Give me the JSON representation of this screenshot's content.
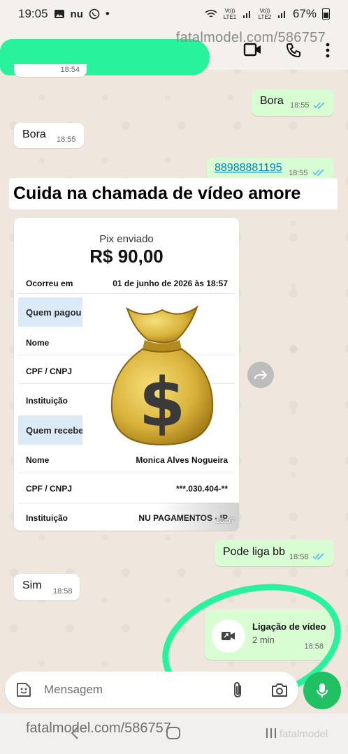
{
  "status_bar": {
    "time": "19:05",
    "left_icons": [
      "gallery-icon",
      "nubank-icon",
      "whatsapp-icon",
      "dot-icon"
    ],
    "nu_label": "nu",
    "sim1": "Vo)) LTE1",
    "sim2": "Vo)) LTE2",
    "battery": "67%"
  },
  "header": {
    "watermark": "fatalmodel.com/586757",
    "icons": [
      "video-call-icon",
      "phone-icon",
      "more-vert-icon"
    ]
  },
  "messages": [
    {
      "id": "m1",
      "direction": "out",
      "text": "Bora",
      "time": "18:55",
      "status": "read"
    },
    {
      "id": "m2",
      "direction": "in",
      "text": "Bora",
      "time": "18:55"
    },
    {
      "id": "m3",
      "direction": "out",
      "text": "88988881195",
      "time": "18:55",
      "status": "read",
      "is_link": true
    },
    {
      "id": "m5",
      "direction": "out",
      "text": "Pode liga bb",
      "time": "18:58",
      "status": "read"
    },
    {
      "id": "m6",
      "direction": "in",
      "text": "Sim",
      "time": "18:58"
    }
  ],
  "partial_time_top": "18:54",
  "caption": "Cuida na chamada de vídeo amore",
  "receipt": {
    "title": "Pix enviado",
    "amount": "R$ 90,00",
    "occurred_label": "Ocorreu em",
    "occurred_value": "01 de junho de 2026 às 18:57",
    "payer_section": "Quem pagou",
    "receiver_section": "Quem recebeu",
    "name_label": "Nome",
    "cpf_label": "CPF / CNPJ",
    "inst_label": "Instituição",
    "receiver_name": "Monica Alves Nogueira",
    "receiver_cpf": "***.030.404-**",
    "receiver_inst": "NU PAGAMENTOS - IP",
    "time": "18:57",
    "overlay": "money-bag-emoji"
  },
  "call": {
    "title": "Ligação de vídeo",
    "duration": "2 min",
    "time": "18:58"
  },
  "input": {
    "placeholder": "Mensagem"
  },
  "footer": {
    "watermark": "fatalmodel.com/586757",
    "logo_text": "fatalmodel"
  },
  "colors": {
    "outgoing": "#d9fdd3",
    "incoming": "#ffffff",
    "accent_green": "#21c063",
    "highlight": "#29f29c",
    "read_ticks": "#53bdeb"
  }
}
